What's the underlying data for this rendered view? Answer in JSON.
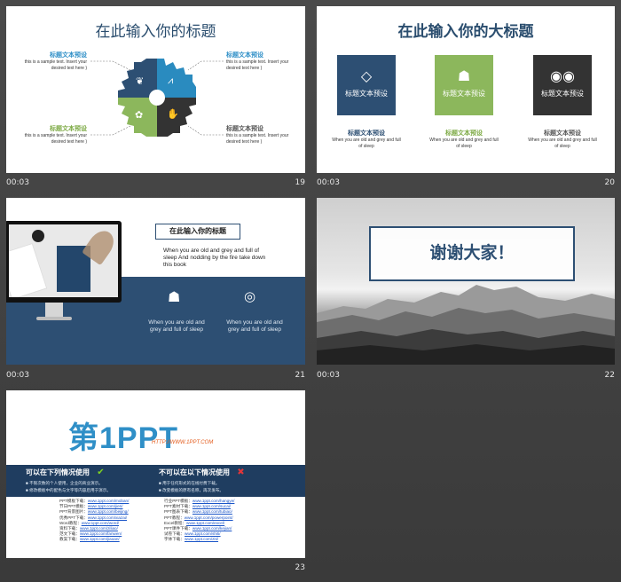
{
  "slides": [
    {
      "time": "00:03",
      "number": "19",
      "title": "在此输入你的标题",
      "items": [
        {
          "label": "标题文本预设",
          "text": "this is a sample text. Insert your desired text here )"
        },
        {
          "label": "标题文本预设",
          "text": "this is a sample text. Insert your desired text here )"
        },
        {
          "label": "标题文本预设",
          "text": "this is a sample text. Insert your desired text here )"
        },
        {
          "label": "标题文本预设",
          "text": "this is a sample text. Insert your desired text here )"
        }
      ]
    },
    {
      "time": "00:03",
      "number": "20",
      "title": "在此输入你的大标题",
      "boxes": [
        {
          "label": "标题文本预设",
          "caption": "标题文本预设",
          "text": "When you are old and grey and full of sleep"
        },
        {
          "label": "标题文本预设",
          "caption": "标题文本预设",
          "text": "When you are old and grey and full of sleep"
        },
        {
          "label": "标题文本预设",
          "caption": "标题文本预设",
          "text": "When you are old and grey and full of sleep"
        }
      ]
    },
    {
      "time": "00:03",
      "number": "21",
      "title": "在此输入你的标题",
      "body": "When you are old and grey and full of sleep And nodding by the fire take down this book",
      "icon_texts": [
        "When you are old and grey and full of sleep",
        "When you are old and grey and full of sleep"
      ]
    },
    {
      "time": "00:03",
      "number": "22",
      "thanks": "谢谢大家！"
    },
    {
      "number": "23",
      "logo_main": "第1PPT",
      "logo_url": "HTTP://WWW.1PPT.COM",
      "can_title": "可以在下列情况使用",
      "cannot_title": "不可以在以下情况使用",
      "can_items": [
        "不限次数的个人使用，企业的商业演示。",
        "修改模板中的配色与文字等内容后用于演示。"
      ],
      "cannot_items": [
        "用于任何形式的在线付费下载。",
        "改变模板的原有名称，再次发布。"
      ],
      "left_links": [
        {
          "k": "PPT模板下载：",
          "v": "www.1ppt.com/moban/"
        },
        {
          "k": "节日PPT模板：",
          "v": "www.1ppt.com/jieri/"
        },
        {
          "k": "PPT背景图片：",
          "v": "www.1ppt.com/beijing/"
        },
        {
          "k": "优秀PPT下载：",
          "v": "www.1ppt.com/xiazai/"
        },
        {
          "k": "Word教程：",
          "v": "www.1ppt.com/word/"
        },
        {
          "k": "资料下载：",
          "v": "www.1ppt.com/ziliao/"
        },
        {
          "k": "范文下载：",
          "v": "www.1ppt.com/fanwen/"
        },
        {
          "k": "教案下载：",
          "v": "www.1ppt.com/jiaoan/"
        }
      ],
      "right_links": [
        {
          "k": "行业PPT模板：",
          "v": "www.1ppt.com/hangye/"
        },
        {
          "k": "PPT素材下载：",
          "v": "www.1ppt.com/sucai/"
        },
        {
          "k": "PPT图表下载：",
          "v": "www.1ppt.com/tubiao/"
        },
        {
          "k": "PPT教程：",
          "v": "www.1ppt.com/powerpoint/"
        },
        {
          "k": "Excel教程：",
          "v": "www.1ppt.com/excel/"
        },
        {
          "k": "PPT课件下载：",
          "v": "www.1ppt.com/kejian/"
        },
        {
          "k": "试卷下载：",
          "v": "www.1ppt.com/shiti/"
        },
        {
          "k": "字体下载：",
          "v": "www.1ppt.com/ziti/"
        }
      ]
    }
  ],
  "colors": {
    "navy": "#2d4f73",
    "green": "#8cb75c",
    "dark": "#333333",
    "blue": "#2f8fc7"
  }
}
